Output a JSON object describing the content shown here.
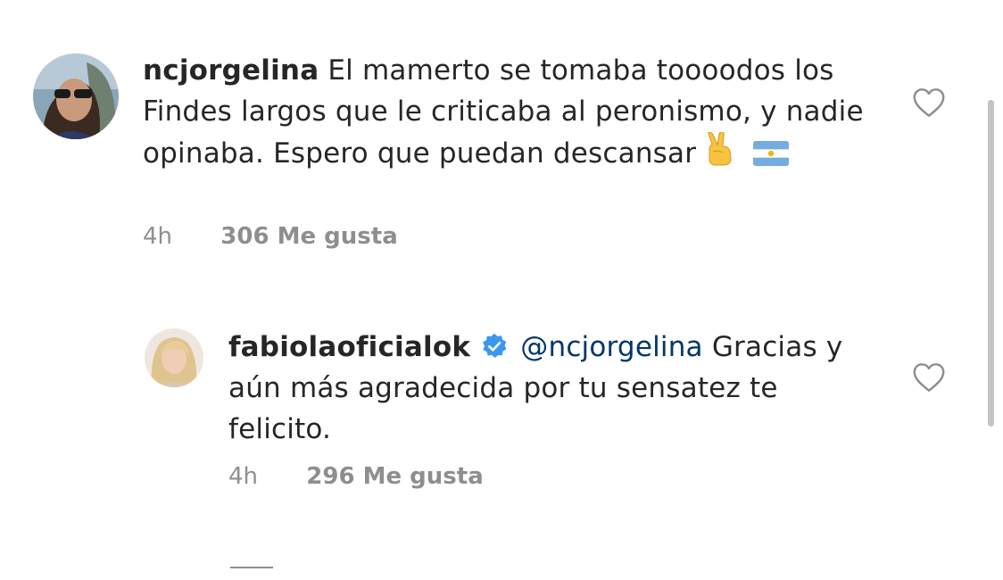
{
  "comments": [
    {
      "username": "ncjorgelina",
      "text": "El mamerto se tomaba toooodos los Findes largos que le criticaba al peronismo, y nadie opinaba. Espero que puedan descansar",
      "emojis": [
        "victory-hand-emoji",
        "argentina-flag-emoji"
      ],
      "time": "4h",
      "likes": "306 Me gusta",
      "icon": "heart-outline-icon"
    },
    {
      "username": "fabiolaoficialok",
      "verified": true,
      "mention": "@ncjorgelina",
      "text": "Gracias y aún más agradecida por tu sensatez te felicito.",
      "time": "4h",
      "likes": "296 Me gusta",
      "icon": "heart-outline-icon"
    }
  ],
  "colors": {
    "text": "#262626",
    "secondary": "#8e8e8e",
    "mention": "#00376b",
    "verified": "#3897f0"
  }
}
